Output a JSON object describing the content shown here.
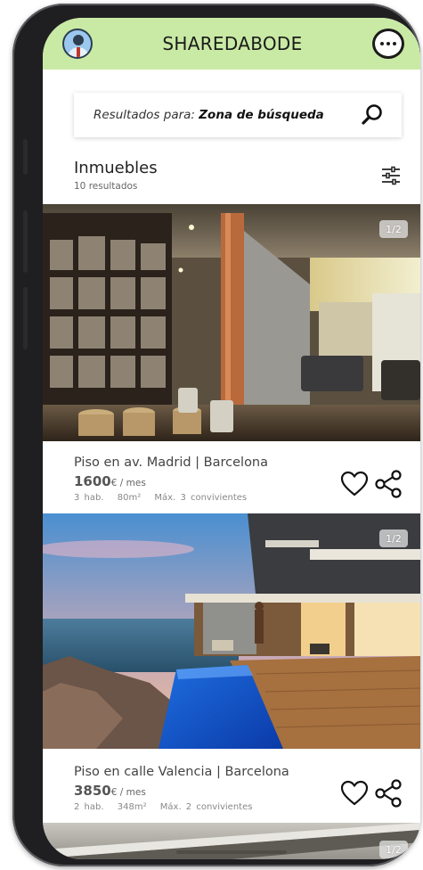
{
  "app": {
    "brand": "SHAREDABODE"
  },
  "search": {
    "prefix": "Resultados para:",
    "query": "Zona de búsqueda"
  },
  "listings_header": {
    "title": "Inmuebles",
    "count": "10 resultados"
  },
  "listings": [
    {
      "title": "Piso en av. Madrid | Barcelona",
      "price": "1600",
      "price_unit": "€ / mes",
      "rooms": "3 hab.",
      "area": "80m²",
      "occupants": "Máx. 3 convivientes",
      "image_badge": "1/2",
      "image_icon": "interior-living-room-photo"
    },
    {
      "title": "Piso en calle Valencia | Barcelona",
      "price": "3850",
      "price_unit": "€ / mes",
      "rooms": "2 hab.",
      "area": "348m²",
      "occupants": "Máx. 2 convivientes",
      "image_badge": "1/2",
      "image_icon": "villa-pool-ocean-photo"
    },
    {
      "image_badge": "1/2",
      "image_icon": "partial-listing-photo"
    }
  ],
  "colors": {
    "header_bg": "#c9eaa4",
    "frame": "#1f1f21"
  }
}
